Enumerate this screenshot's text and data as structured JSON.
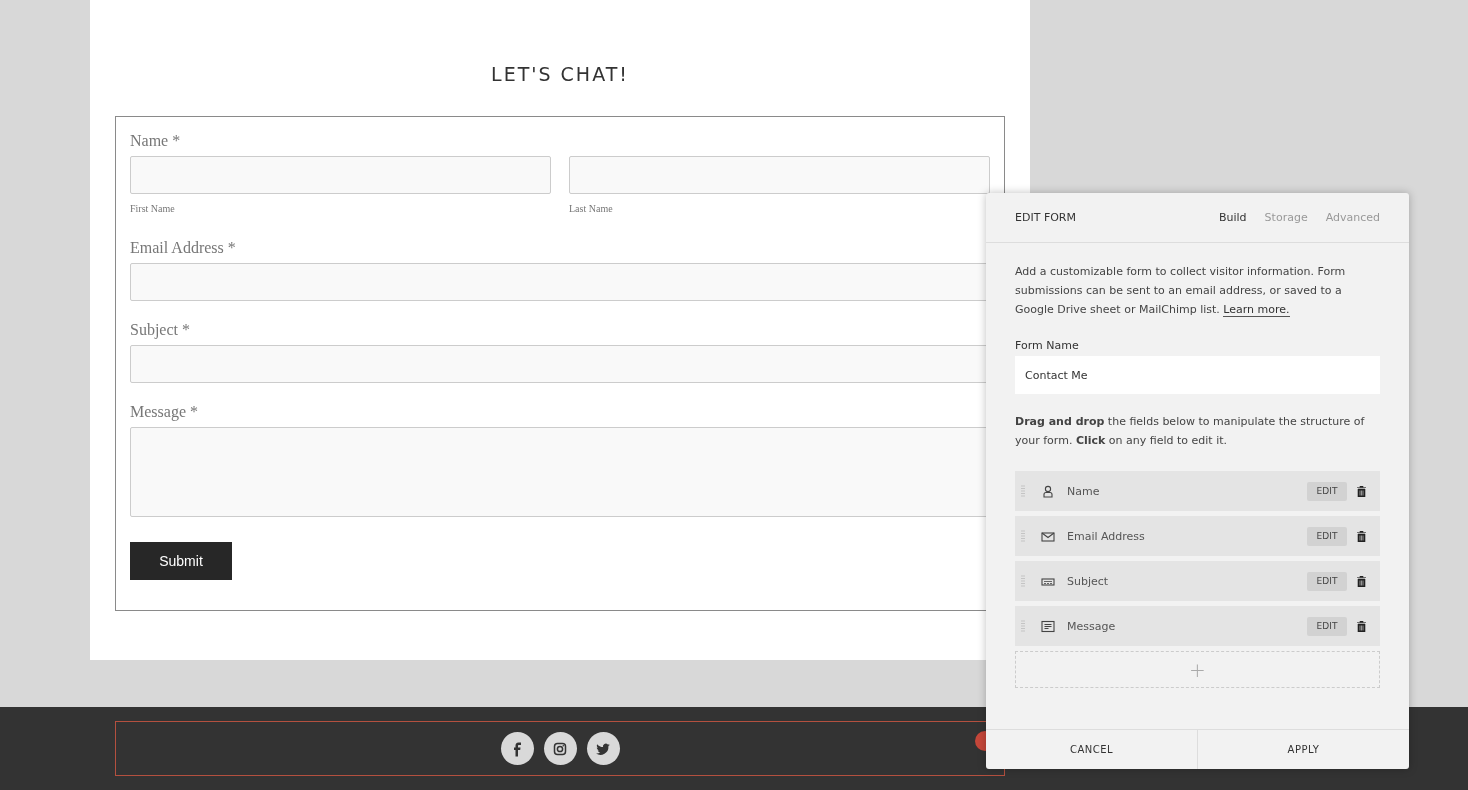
{
  "page": {
    "heading": "LET'S CHAT!"
  },
  "form": {
    "fields": [
      {
        "kind": "name",
        "label": "Name *",
        "sublabels": [
          "First Name",
          "Last Name"
        ]
      },
      {
        "kind": "line",
        "label": "Email Address *"
      },
      {
        "kind": "line",
        "label": "Subject *"
      },
      {
        "kind": "area",
        "label": "Message *"
      }
    ],
    "submit": "Submit"
  },
  "footer": {
    "social": [
      {
        "kind": "facebook"
      },
      {
        "kind": "instagram"
      },
      {
        "kind": "twitter"
      }
    ]
  },
  "panel": {
    "title": "EDIT FORM",
    "tabs": [
      {
        "label": "Build",
        "selected": true
      },
      {
        "label": "Storage",
        "selected": false
      },
      {
        "label": "Advanced",
        "selected": false
      }
    ],
    "intro": "Add a customizable form to collect visitor information. Form submissions can be sent to an email address, or saved to a Google Drive sheet or MailChimp list.",
    "link": "Learn more.",
    "form_name_label": "Form Name",
    "form_name_value": "Contact Me",
    "hint": "**Drag and drop** the fields below to manipulate the structure of your form. **Click** on any field to edit it.",
    "fields": [
      {
        "kind": "person",
        "label": "Name",
        "edit": "EDIT"
      },
      {
        "kind": "mail",
        "label": "Email Address",
        "edit": "EDIT"
      },
      {
        "kind": "text",
        "label": "Subject",
        "edit": "EDIT"
      },
      {
        "kind": "area",
        "label": "Message",
        "edit": "EDIT"
      }
    ],
    "add": "+",
    "buttons": [
      "CANCEL",
      "APPLY"
    ]
  }
}
